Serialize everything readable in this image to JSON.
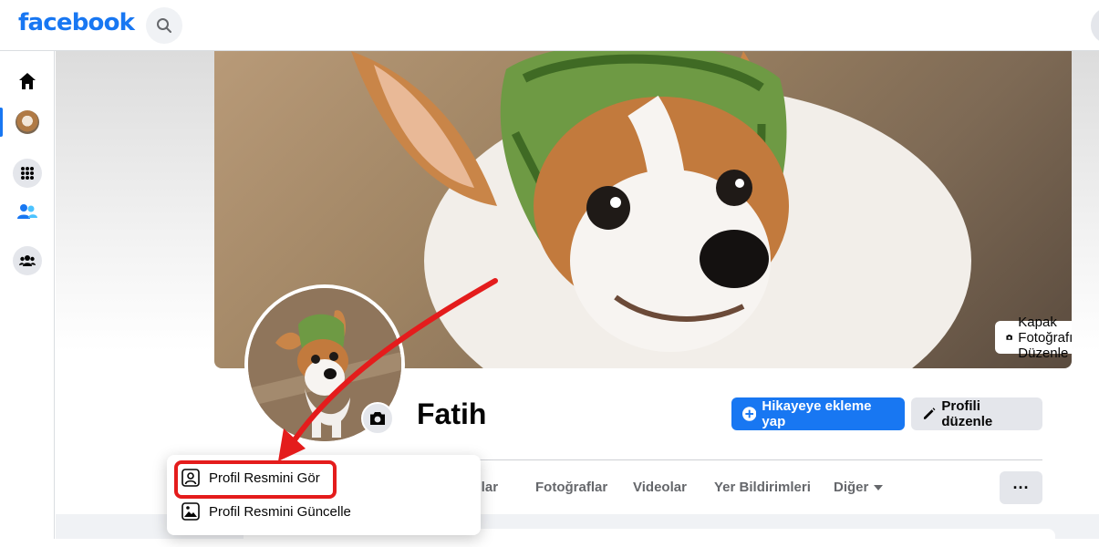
{
  "topbar": {
    "logo": "facebook",
    "search_icon": "search-icon"
  },
  "leftrail": {
    "items": [
      {
        "name": "home",
        "icon": "home-icon"
      },
      {
        "name": "profile",
        "icon": "avatar"
      },
      {
        "name": "menu",
        "icon": "apps-grid-icon"
      },
      {
        "name": "friends",
        "icon": "friends-icon"
      },
      {
        "name": "groups",
        "icon": "groups-icon"
      }
    ]
  },
  "cover": {
    "edit_label": "Kapak Fotoğrafını Düzenle"
  },
  "profile": {
    "name": "Fatih",
    "add_story_label": "Hikayeye ekleme yap",
    "edit_profile_label": "Profili düzenle"
  },
  "tabs": [
    {
      "label": "aşlar"
    },
    {
      "label": "Fotoğraflar"
    },
    {
      "label": "Videolar"
    },
    {
      "label": "Yer Bildirimleri"
    },
    {
      "label": "Diğer"
    }
  ],
  "tab_more_label": "···",
  "pic_menu": {
    "view_label": "Profil Resmini Gör",
    "update_label": "Profil Resmini Güncelle"
  },
  "colors": {
    "brand": "#1877f2",
    "annotation": "#e41c1c",
    "button_gray": "#e4e6eb"
  }
}
